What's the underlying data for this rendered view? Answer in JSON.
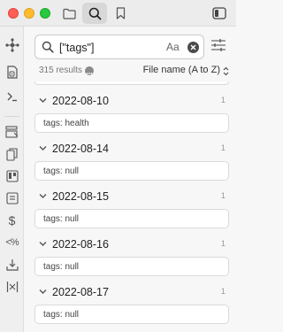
{
  "titlebar": {
    "icons": [
      "folder-icon",
      "search-icon",
      "bookmark-icon",
      "sidebar-toggle-icon"
    ]
  },
  "ribbon": {
    "icons": [
      "graph-view-icon",
      "open-random-note-icon",
      "terminal-icon",
      "templates-icon",
      "copy-icon",
      "kanban-icon",
      "archive-icon",
      "dollar-icon",
      "percent-icon",
      "download-icon",
      "split-view-icon"
    ]
  },
  "search": {
    "query": "[\"tags\"]",
    "match_case_label": "Aa"
  },
  "results": {
    "count_label": "315 results",
    "sort_label": "File name (A to Z)"
  },
  "groups": [
    {
      "title": "2022-08-10",
      "count": "1",
      "match": "tags: health"
    },
    {
      "title": "2022-08-14",
      "count": "1",
      "match": "tags: null"
    },
    {
      "title": "2022-08-15",
      "count": "1",
      "match": "tags: null"
    },
    {
      "title": "2022-08-16",
      "count": "1",
      "match": "tags: null"
    },
    {
      "title": "2022-08-17",
      "count": "1",
      "match": "tags: null"
    }
  ]
}
